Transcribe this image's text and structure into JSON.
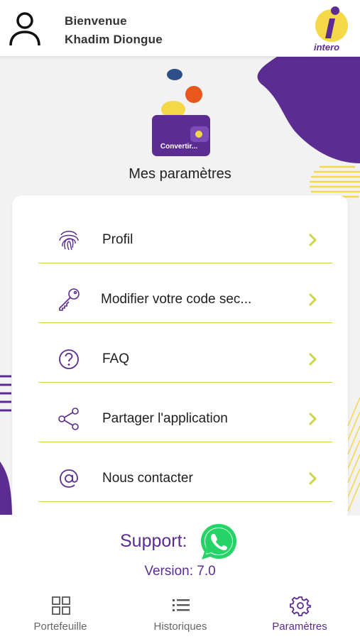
{
  "header": {
    "greeting": "Bienvenue",
    "user_name": "Khadim Diongue",
    "logo_text": "intero"
  },
  "hero": {
    "wallet_label": "Convertir...",
    "title": "Mes paramètres"
  },
  "menu": {
    "items": [
      {
        "label": "Profil",
        "icon": "fingerprint-icon"
      },
      {
        "label": "Modifier votre code sec...",
        "icon": "key-icon"
      },
      {
        "label": "FAQ",
        "icon": "question-circle-icon"
      },
      {
        "label": "Partager l'application",
        "icon": "share-icon"
      },
      {
        "label": "Nous contacter",
        "icon": "at-sign-icon"
      }
    ]
  },
  "support": {
    "label": "Support:",
    "icon": "whatsapp-icon",
    "version": "Version: 7.0"
  },
  "nav": {
    "items": [
      {
        "label": "Portefeuille",
        "icon": "grid-icon",
        "active": false
      },
      {
        "label": "Historiques",
        "icon": "list-icon",
        "active": false
      },
      {
        "label": "Paramètres",
        "icon": "gear-icon",
        "active": true
      }
    ]
  },
  "colors": {
    "brand_purple": "#5b2c91",
    "accent_lime": "#cdd64a",
    "accent_yellow": "#f5d848",
    "accent_orange": "#e8571b",
    "whatsapp_green": "#25d366"
  }
}
